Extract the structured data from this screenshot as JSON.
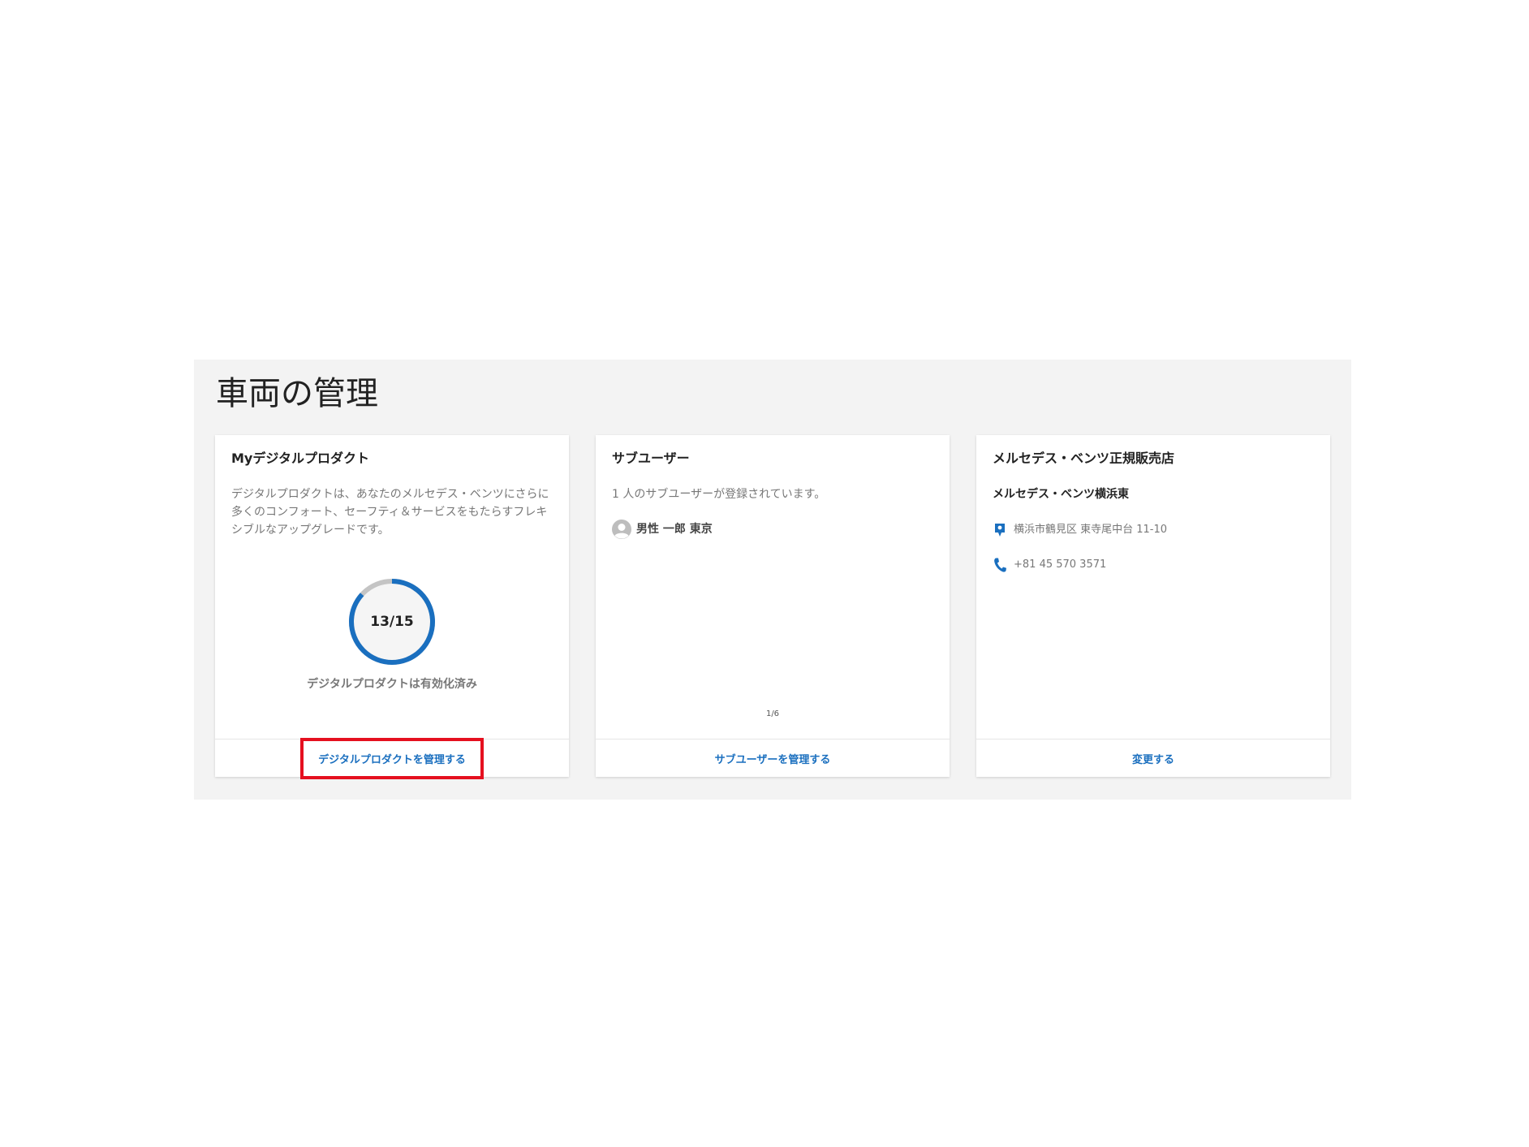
{
  "page": {
    "title": "車両の管理"
  },
  "digital_products": {
    "title": "Myデジタルプロダクト",
    "description": "デジタルプロダクトは、あなたのメルセデス・ベンツにさらに多くのコンフォート、セーフティ＆サービスをもたらすフレキシブルなアップグレードです。",
    "progress": {
      "activated": 13,
      "total": 15,
      "label": "13/15",
      "caption": "デジタルプロダクトは有効化済み"
    },
    "manage_link": "デジタルプロダクトを管理する"
  },
  "sub_users": {
    "title": "サブユーザー",
    "summary": "1 人のサブユーザーが登録されています。",
    "users": [
      {
        "name": "男性 一郎 東京",
        "icon": "avatar-icon"
      }
    ],
    "pagination": "1/6",
    "manage_link": "サブユーザーを管理する"
  },
  "dealer": {
    "title": "メルセデス・ベンツ正規販売店",
    "name": "メルセデス・ベンツ横浜東",
    "address": "横浜市鶴見区 東寺尾中台 11-10",
    "phone": "+81 45 570 3571",
    "change_link": "変更する",
    "icons": {
      "address": "location-pin-icon",
      "phone": "phone-icon"
    }
  },
  "colors": {
    "accent": "#1a6fbf",
    "ring_track": "#c4c4c4",
    "highlight": "#e5101f",
    "panel_bg": "#f3f3f3"
  }
}
